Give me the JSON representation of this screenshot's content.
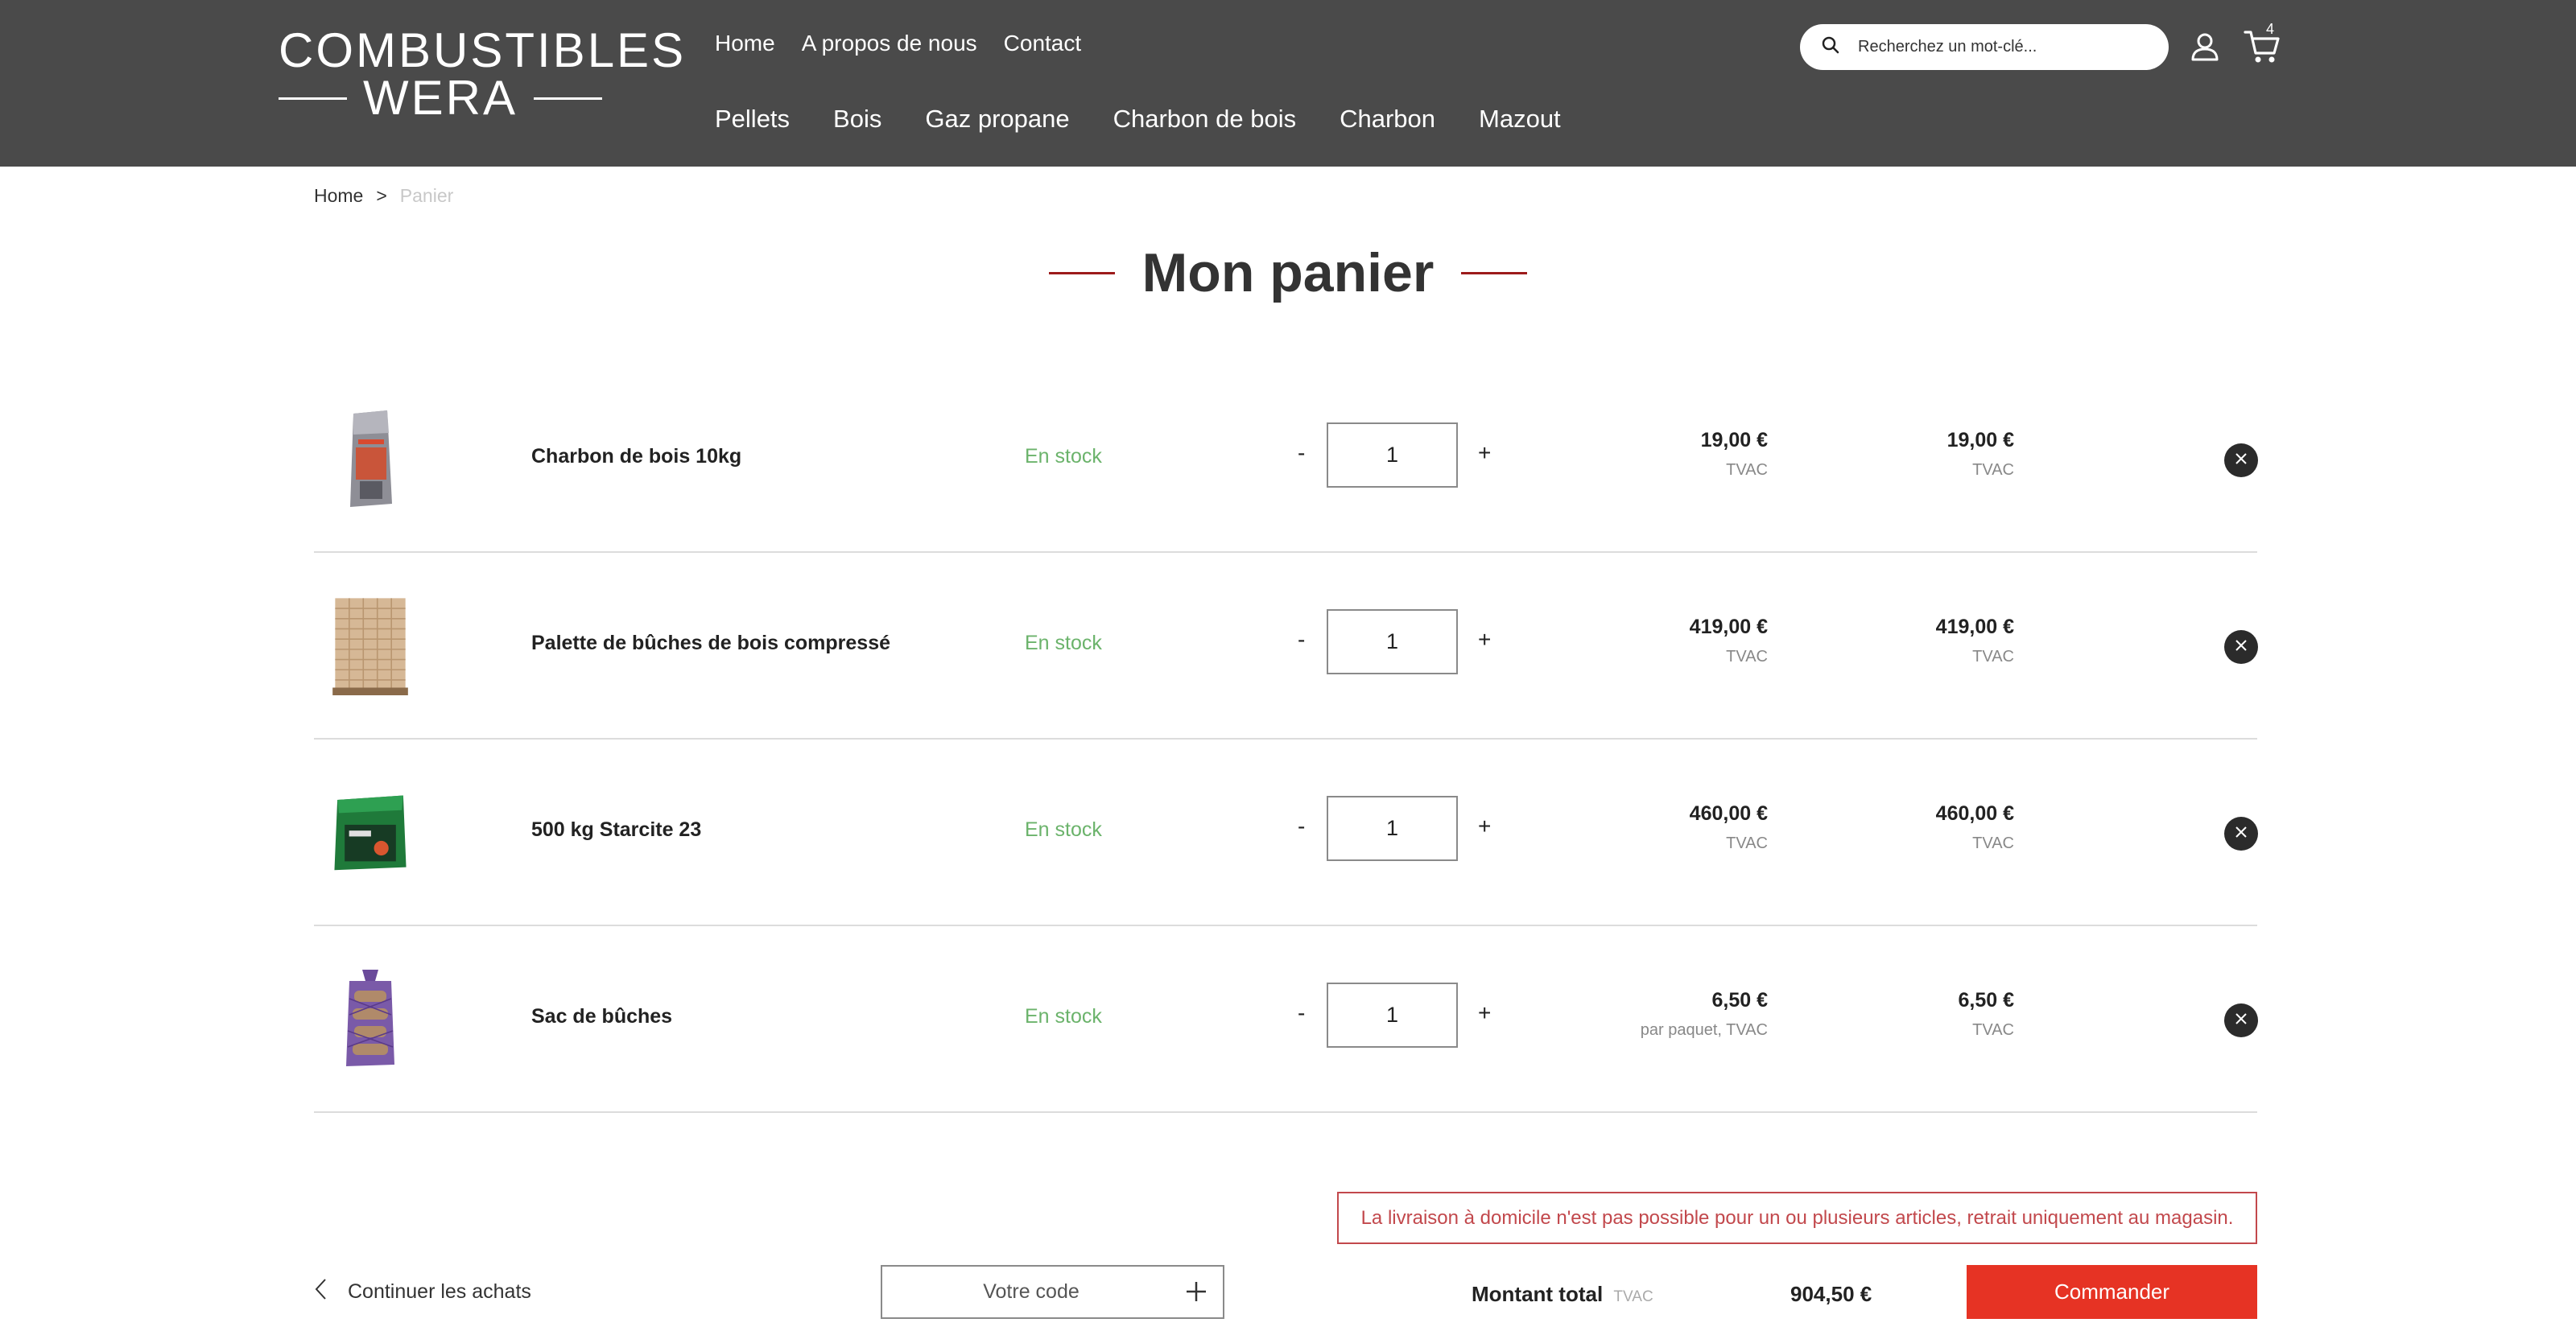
{
  "header": {
    "logo_top": "COMBUSTIBLES",
    "logo_bottom": "WERA",
    "top_nav": [
      "Home",
      "A propos de nous",
      "Contact"
    ],
    "main_nav": [
      "Pellets",
      "Bois",
      "Gaz propane",
      "Charbon de bois",
      "Charbon",
      "Mazout"
    ],
    "search_placeholder": "Recherchez un mot-clé...",
    "cart_count": "4",
    "icons": [
      "search-icon",
      "user-icon",
      "cart-icon"
    ]
  },
  "breadcrumb": {
    "home": "Home",
    "separator": ">",
    "current": "Panier"
  },
  "page_title": "Mon panier",
  "cart": {
    "items": [
      {
        "name": "Charbon de bois 10kg",
        "stock": "En stock",
        "quantity": "1",
        "minus": "-",
        "plus": "+",
        "unit_price": "19,00 €",
        "unit_note": "TVAC",
        "total_price": "19,00 €",
        "total_note": "TVAC"
      },
      {
        "name": "Palette de bûches de bois compressé",
        "stock": "En stock",
        "quantity": "1",
        "minus": "-",
        "plus": "+",
        "unit_price": "419,00 €",
        "unit_note": "TVAC",
        "total_price": "419,00 €",
        "total_note": "TVAC"
      },
      {
        "name": "500 kg Starcite 23",
        "stock": "En stock",
        "quantity": "1",
        "minus": "-",
        "plus": "+",
        "unit_price": "460,00 €",
        "unit_note": "TVAC",
        "total_price": "460,00 €",
        "total_note": "TVAC"
      },
      {
        "name": "Sac de bûches",
        "stock": "En stock",
        "quantity": "1",
        "minus": "-",
        "plus": "+",
        "unit_price": "6,50 €",
        "unit_note": "par paquet, TVAC",
        "total_price": "6,50 €",
        "total_note": "TVAC"
      }
    ]
  },
  "notice": "La livraison à domicile n'est pas possible pour un ou plusieurs articles, retrait uniquement au magasin.",
  "footer": {
    "continue_label": "Continuer les achats",
    "coupon_placeholder": "Votre code",
    "total_label": "Montant total",
    "total_tax": "TVAC",
    "total_amount": "904,50 €",
    "order_label": "Commander"
  },
  "colors": {
    "header_bg": "#4a4a4a",
    "accent_red": "#e63324",
    "title_line": "#9c1b1b",
    "stock_green": "#6bb36b",
    "notice_red": "#c2484c"
  }
}
